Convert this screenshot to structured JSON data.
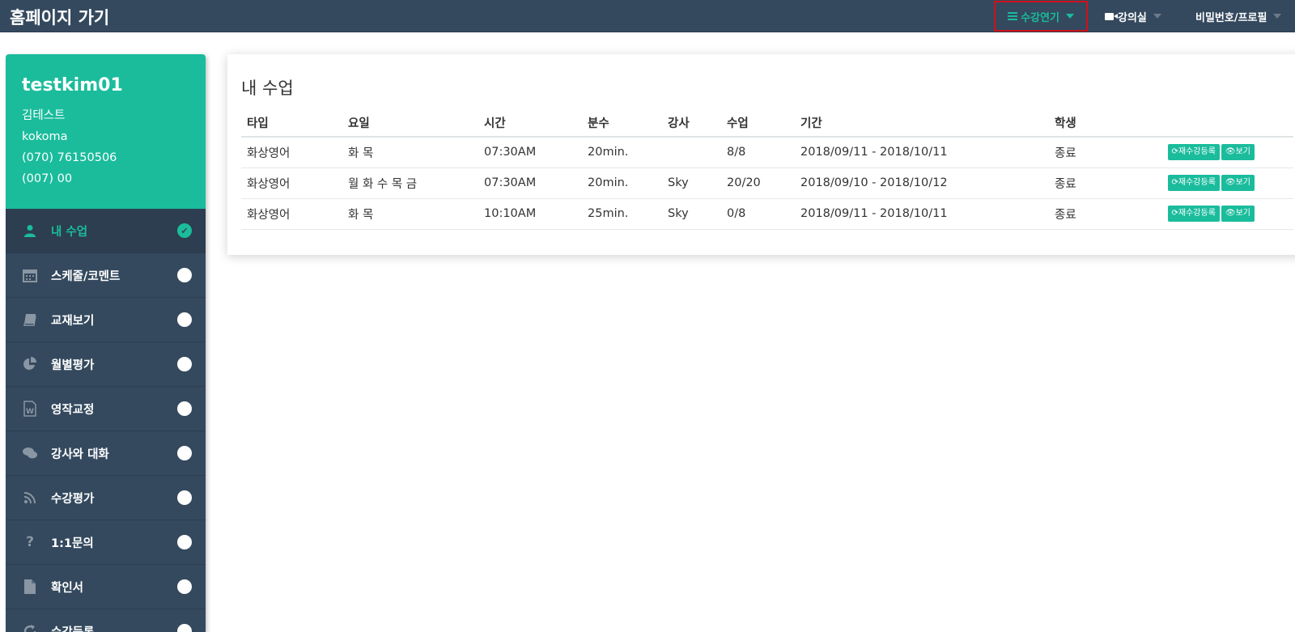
{
  "header": {
    "brand": "홈페이지 가기",
    "nav": {
      "courses": "수강연기",
      "classroom": "강의실",
      "profile": "비밀번호/프로필"
    }
  },
  "sidebar": {
    "profile": {
      "username": "testkim01",
      "name": "김테스트",
      "org": "kokoma",
      "phone1": "(070) 76150506",
      "phone2": "(007) 00"
    },
    "items": [
      {
        "label": "내 수업",
        "icon": "user-icon",
        "active": true
      },
      {
        "label": "스케줄/코멘트",
        "icon": "calendar-icon"
      },
      {
        "label": "교재보기",
        "icon": "book-icon"
      },
      {
        "label": "월별평가",
        "icon": "pie-chart-icon"
      },
      {
        "label": "영작교정",
        "icon": "word-file-icon"
      },
      {
        "label": "강사와 대화",
        "icon": "comments-icon"
      },
      {
        "label": "수강평가",
        "icon": "rss-icon"
      },
      {
        "label": "1:1문의",
        "icon": "question-icon"
      },
      {
        "label": "확인서",
        "icon": "file-icon"
      },
      {
        "label": "수강등록",
        "icon": "refresh-icon"
      }
    ]
  },
  "main": {
    "title": "내 수업",
    "columns": [
      "타입",
      "요일",
      "시간",
      "분수",
      "강사",
      "수업",
      "기간",
      "학생"
    ],
    "rows": [
      {
        "type": "화상영어",
        "days": "화 목",
        "time": "07:30AM",
        "minutes": "20min.",
        "teacher": "",
        "lessons": "8/8",
        "period": "2018/09/11 - 2018/10/11",
        "status": "종료"
      },
      {
        "type": "화상영어",
        "days": "월 화 수 목 금",
        "time": "07:30AM",
        "minutes": "20min.",
        "teacher": "Sky",
        "lessons": "20/20",
        "period": "2018/09/10 - 2018/10/12",
        "status": "종료"
      },
      {
        "type": "화상영어",
        "days": "화 목",
        "time": "10:10AM",
        "minutes": "25min.",
        "teacher": "Sky",
        "lessons": "0/8",
        "period": "2018/09/11 - 2018/10/11",
        "status": "종료"
      }
    ],
    "buttons": {
      "reregister": "재수강등록",
      "view": "보기"
    }
  },
  "colors": {
    "accent": "#1abc9c",
    "nav_bg": "#34495e",
    "highlight_border": "#d0101a"
  }
}
